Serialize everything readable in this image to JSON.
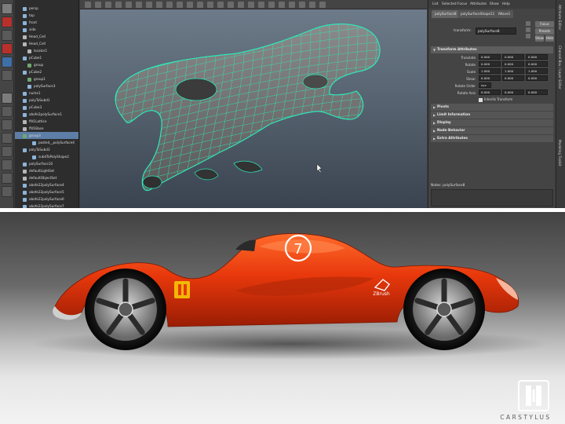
{
  "maya": {
    "outliner": {
      "items": [
        {
          "label": "persp",
          "kind": "cam",
          "indent": 1,
          "selected": false
        },
        {
          "label": "top",
          "kind": "cam",
          "indent": 1,
          "selected": false
        },
        {
          "label": "front",
          "kind": "cam",
          "indent": 1,
          "selected": false
        },
        {
          "label": "side",
          "kind": "cam",
          "indent": 1,
          "selected": false
        },
        {
          "label": "Head_Cell",
          "kind": "tf",
          "indent": 1,
          "selected": false
        },
        {
          "label": "Head_Cell",
          "kind": "tf",
          "indent": 1,
          "selected": false
        },
        {
          "label": "locator1",
          "kind": "tf",
          "indent": 2,
          "selected": false
        },
        {
          "label": "pCube1",
          "kind": "mesh",
          "indent": 1,
          "selected": false
        },
        {
          "label": "group",
          "kind": "gr",
          "indent": 2,
          "selected": false
        },
        {
          "label": "pCube2",
          "kind": "mesh",
          "indent": 1,
          "selected": false
        },
        {
          "label": "group1",
          "kind": "gr",
          "indent": 2,
          "selected": false
        },
        {
          "label": "polySurface3",
          "kind": "mesh",
          "indent": 2,
          "selected": false
        },
        {
          "label": "nurbs1",
          "kind": "mesh",
          "indent": 1,
          "selected": false
        },
        {
          "label": "polyToSubd1",
          "kind": "mesh",
          "indent": 1,
          "selected": false
        },
        {
          "label": "pCube3",
          "kind": "mesh",
          "indent": 1,
          "selected": false
        },
        {
          "label": "abofe2polySurface1",
          "kind": "mesh",
          "indent": 1,
          "selected": false
        },
        {
          "label": "ffd1Lattice",
          "kind": "tf",
          "indent": 1,
          "selected": false
        },
        {
          "label": "ffd1Base",
          "kind": "tf",
          "indent": 1,
          "selected": false
        },
        {
          "label": "group3",
          "kind": "gr",
          "indent": 1,
          "selected": true
        },
        {
          "label": "pasted__polySurface4",
          "kind": "mesh",
          "indent": 3,
          "selected": false
        },
        {
          "label": "polyToSubd3",
          "kind": "mesh",
          "indent": 1,
          "selected": false
        },
        {
          "label": "subdToPolyShape2",
          "kind": "mesh",
          "indent": 3,
          "selected": false
        },
        {
          "label": "polySurface10",
          "kind": "mesh",
          "indent": 1,
          "selected": false
        },
        {
          "label": "defaultLightSet",
          "kind": "tf",
          "indent": 1,
          "selected": false
        },
        {
          "label": "defaultObjectSet",
          "kind": "tf",
          "indent": 1,
          "selected": false
        },
        {
          "label": "abofe22polySurface4",
          "kind": "mesh",
          "indent": 1,
          "selected": false
        },
        {
          "label": "abofe22polySurface5",
          "kind": "mesh",
          "indent": 1,
          "selected": false
        },
        {
          "label": "abofe22polySurface6",
          "kind": "mesh",
          "indent": 1,
          "selected": false
        },
        {
          "label": "abofe22polySurface7",
          "kind": "mesh",
          "indent": 1,
          "selected": false
        }
      ]
    },
    "attribute_editor": {
      "menu": [
        "List",
        "Selected",
        "Focus",
        "Attributes",
        "Show",
        "Help"
      ],
      "tabs": [
        "polySurface8",
        "polySurfaceShape11",
        "lWave1"
      ],
      "active_tab": 0,
      "transform_label": "transform:",
      "transform_value": "polySurface8",
      "buttons": {
        "focus": "Focus",
        "presets": "Presets",
        "show": "Show",
        "hide": "Hide"
      },
      "sections": {
        "transform": "Transform Attributes",
        "pivots": "Pivots",
        "limit": "Limit Information",
        "display": "Display",
        "node": "Node Behavior",
        "extra": "Extra Attributes"
      },
      "rows": [
        {
          "label": "Translate",
          "values": [
            "0.000",
            "0.000",
            "0.000"
          ]
        },
        {
          "label": "Rotate",
          "values": [
            "0.000",
            "0.000",
            "0.000"
          ]
        },
        {
          "label": "Scale",
          "values": [
            "1.000",
            "1.000",
            "1.000"
          ]
        },
        {
          "label": "Shear",
          "values": [
            "0.000",
            "0.000",
            "0.000"
          ]
        }
      ],
      "rotate_order_label": "Rotate Order",
      "rotate_order_value": "xyz",
      "rotate_axis_label": "Rotate Axis",
      "rotate_axis_values": [
        "0.000",
        "0.000",
        "0.000"
      ],
      "inherits_label": "Inherits Transform",
      "notes_label": "Notes: polySurface8"
    },
    "side_tabs": [
      "Attribute Editor",
      "Channel Box / Layer Editor",
      "Modeling Toolkit"
    ],
    "colors": {
      "wire": "#2ee8b8",
      "selected": "#5d7ea6"
    }
  },
  "render": {
    "car_number": "7",
    "zbrush_label": "ZBrush",
    "brand_name": "CARSTYLUS",
    "colors": {
      "body": "#e8380c",
      "logo": "#f2b705"
    }
  }
}
